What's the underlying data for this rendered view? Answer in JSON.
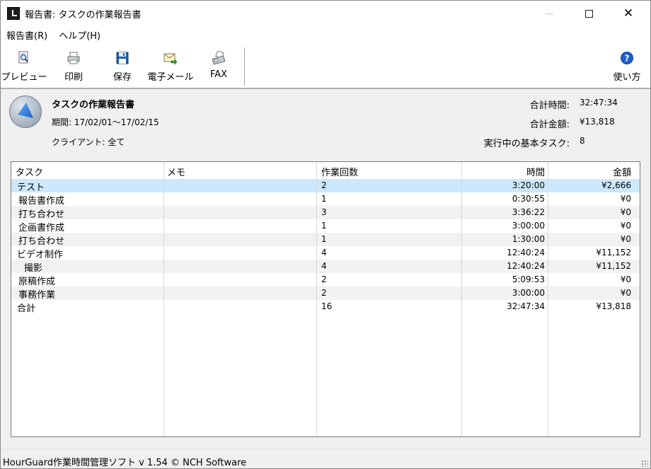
{
  "window": {
    "title": "報告書: タスクの作業報告書",
    "controls": {
      "minimize": "—",
      "maximize": "□",
      "close": "✕"
    }
  },
  "menu": [
    {
      "label": "報告書(R)"
    },
    {
      "label": "ヘルプ(H)"
    }
  ],
  "toolbar": {
    "preview": "プレビュー",
    "print": "印刷",
    "save": "保存",
    "email": "電子メール",
    "fax": "FAX",
    "help": "使い方",
    "icons": {
      "preview": "magnifier-page-icon",
      "print": "printer-icon",
      "save": "floppy-disk-icon",
      "email": "envelope-arrow-icon",
      "fax": "fax-machine-icon",
      "help": "question-circle-icon"
    }
  },
  "report": {
    "title": "タスクの作業報告書",
    "period": "期間: 17/02/01～17/02/15",
    "client": "クライアント: 全て",
    "summary": [
      {
        "label": "合計時間:",
        "value": "32:47:34"
      },
      {
        "label": "合計金額:",
        "value": "¥13,818"
      },
      {
        "label": "実行中の基本タスク:",
        "value": "8"
      }
    ]
  },
  "table": {
    "columns": [
      "タスク",
      "メモ",
      "作業回数",
      "時間",
      "金額"
    ],
    "rows": [
      {
        "task": "テスト",
        "memo": "",
        "count": "2",
        "time": "3:20:00",
        "amount": "¥2,666"
      },
      {
        "task": "報告書作成",
        "memo": "",
        "count": "1",
        "time": "0:30:55",
        "amount": "¥0"
      },
      {
        "task": "打ち合わせ",
        "memo": "",
        "count": "3",
        "time": "3:36:22",
        "amount": "¥0"
      },
      {
        "task": "企画書作成",
        "memo": "",
        "count": "1",
        "time": "3:00:00",
        "amount": "¥0"
      },
      {
        "task": "打ち合わせ",
        "memo": "",
        "count": "1",
        "time": "1:30:00",
        "amount": "¥0"
      },
      {
        "task": "ビデオ制作",
        "memo": "",
        "count": "4",
        "time": "12:40:24",
        "amount": "¥11,152"
      },
      {
        "task": "撮影",
        "memo": "",
        "count": "4",
        "time": "12:40:24",
        "amount": "¥11,152"
      },
      {
        "task": "原稿作成",
        "memo": "",
        "count": "2",
        "time": "5:09:53",
        "amount": "¥0"
      },
      {
        "task": "事務作業",
        "memo": "",
        "count": "2",
        "time": "3:00:00",
        "amount": "¥0"
      },
      {
        "task": "合計",
        "memo": "",
        "count": "16",
        "time": "32:47:34",
        "amount": "¥13,818"
      }
    ]
  },
  "status": {
    "text": "HourGuard作業時間管理ソフト v 1.54 © NCH Software"
  },
  "colors": {
    "selected_row": "#cce8ff",
    "alt_row": "#f2f2f2",
    "panel": "#f0f0f0",
    "accent": "#1a5fc2"
  }
}
